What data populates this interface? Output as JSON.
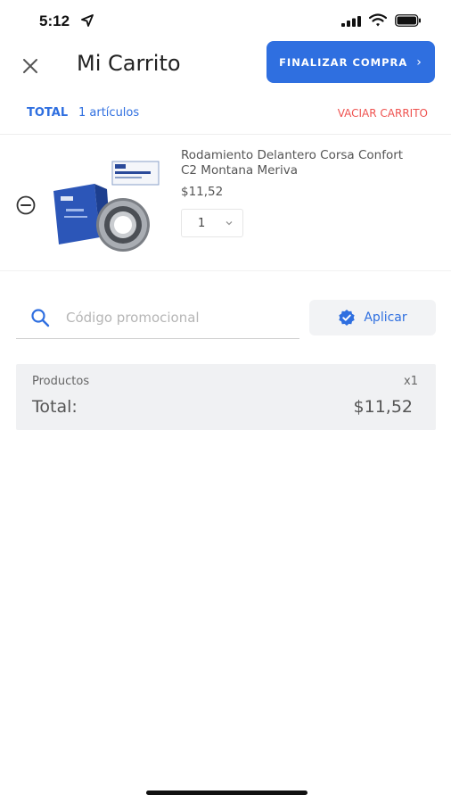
{
  "status_bar": {
    "time": "5:12",
    "icons": [
      "location-arrow-icon",
      "signal-icon",
      "wifi-icon",
      "battery-icon"
    ]
  },
  "header": {
    "close_icon": "close-icon",
    "title": "Mi Carrito",
    "checkout_label": "FINALIZAR COMPRA",
    "checkout_chevron": "›"
  },
  "summary": {
    "total_label": "TOTAL",
    "item_count": "1 artículos",
    "empty_cart_label": "VACIAR CARRITO"
  },
  "cart_items": [
    {
      "name": "Rodamiento Delantero Corsa Confort C2 Montana Meriva",
      "price": "$11,52",
      "quantity": "1",
      "remove_icon": "minus-circle-icon",
      "image": "wheel-bearing-product-image"
    }
  ],
  "promo": {
    "placeholder": "Código promocional",
    "value": "",
    "apply_label": "Aplicar",
    "search_icon": "search-icon",
    "apply_icon": "verified-check-icon"
  },
  "totals": {
    "products_label": "Productos",
    "products_qty": "x1",
    "total_label": "Total:",
    "total_amount": "$11,52"
  },
  "colors": {
    "accent": "#2f6fe0",
    "danger": "#ef5350",
    "panel_bg": "#f0f1f3"
  }
}
